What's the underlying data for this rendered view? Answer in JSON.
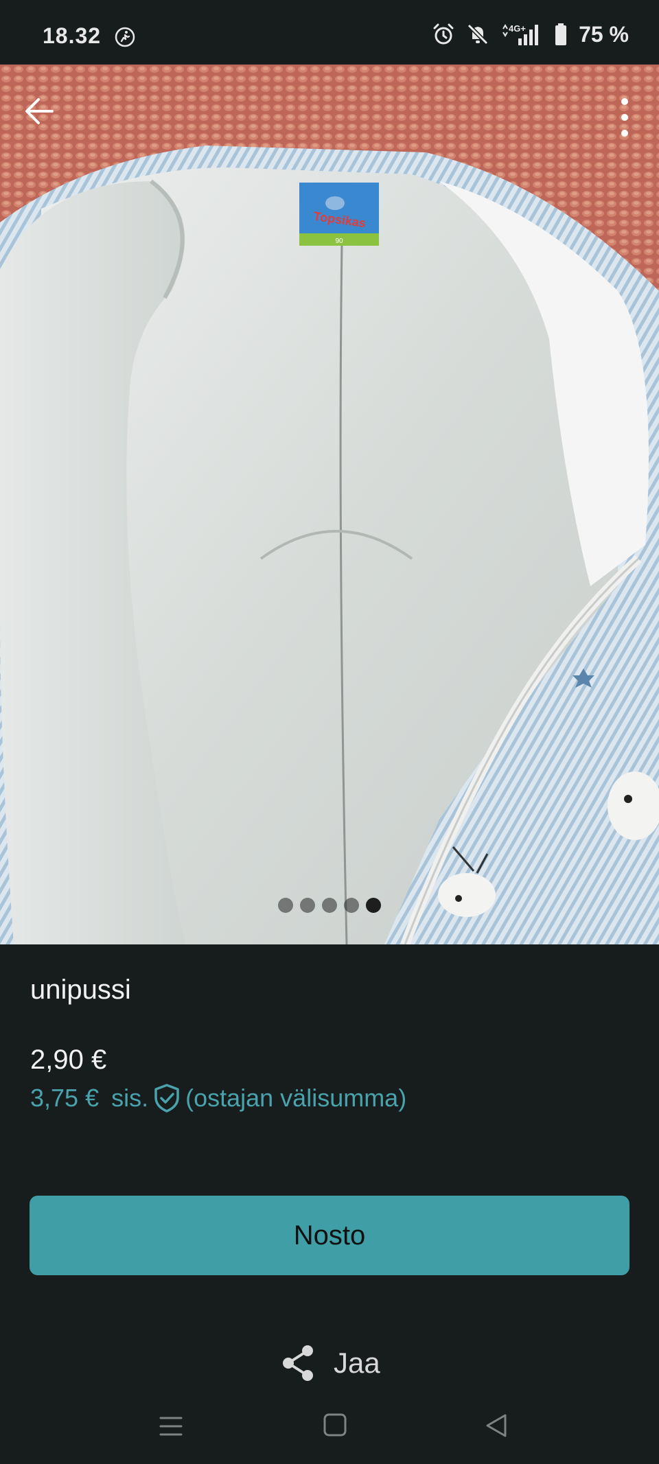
{
  "status_bar": {
    "time": "18.32",
    "battery": "75 %",
    "network": "4G+",
    "icons": [
      "activity-icon",
      "alarm-icon",
      "mute-icon",
      "signal-icon",
      "battery-icon"
    ]
  },
  "header": {
    "back_icon": "arrow-left-icon",
    "menu_icon": "more-vertical-icon"
  },
  "gallery": {
    "image_count": 5,
    "active_index": 4,
    "label_text": "Topsikas",
    "label_size": "90"
  },
  "listing": {
    "title": "unipussi",
    "price": "2,90 €",
    "buyer_price": "3,75 €",
    "buyer_price_prefix": "sis.",
    "buyer_price_note": "(ostajan välisumma)"
  },
  "actions": {
    "primary_label": "Nosto",
    "share_label": "Jaa"
  },
  "colors": {
    "background": "#171c1d",
    "accent": "#409ea7",
    "accent_text": "#4aa3ac"
  }
}
